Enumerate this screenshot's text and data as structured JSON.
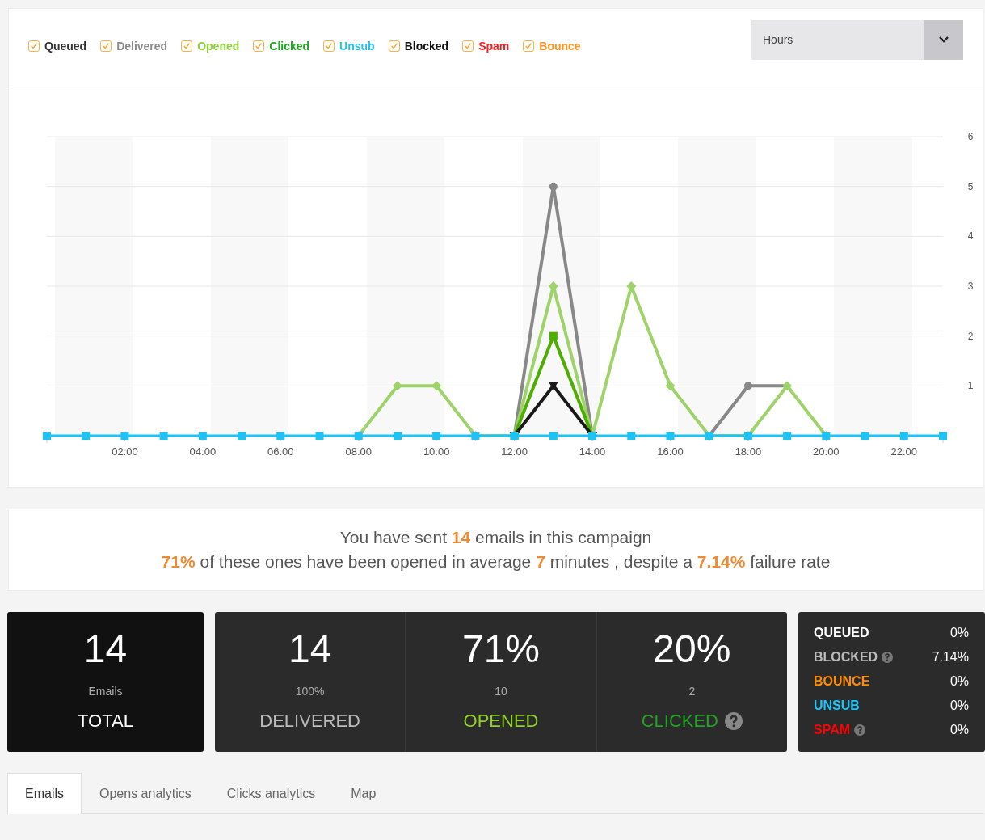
{
  "legend": [
    {
      "label": "Queued",
      "checked": true,
      "color": "#333333"
    },
    {
      "label": "Delivered",
      "checked": true,
      "color": "#8a8a8a"
    },
    {
      "label": "Opened",
      "checked": true,
      "color": "#8fd13a"
    },
    {
      "label": "Clicked",
      "checked": true,
      "color": "#1fa51f"
    },
    {
      "label": "Unsub",
      "checked": true,
      "color": "#1ec3f5"
    },
    {
      "label": "Blocked",
      "checked": true,
      "color": "#111111"
    },
    {
      "label": "Spam",
      "checked": true,
      "color": "#ff1a1a"
    },
    {
      "label": "Bounce",
      "checked": true,
      "color": "#ff9019"
    }
  ],
  "period_select": {
    "value": "Hours"
  },
  "chart_data": {
    "type": "line",
    "grid": true,
    "x": [
      0,
      1,
      2,
      3,
      4,
      5,
      6,
      7,
      8,
      9,
      10,
      11,
      12,
      13,
      14,
      15,
      16,
      17,
      18,
      19,
      20,
      21,
      22,
      23
    ],
    "xlim": [
      0,
      23
    ],
    "ylim": [
      0,
      6
    ],
    "xticks": [
      {
        "value": 2,
        "label": "02:00"
      },
      {
        "value": 4,
        "label": "04:00"
      },
      {
        "value": 6,
        "label": "06:00"
      },
      {
        "value": 8,
        "label": "08:00"
      },
      {
        "value": 10,
        "label": "10:00"
      },
      {
        "value": 12,
        "label": "12:00"
      },
      {
        "value": 14,
        "label": "14:00"
      },
      {
        "value": 16,
        "label": "16:00"
      },
      {
        "value": 18,
        "label": "18:00"
      },
      {
        "value": 20,
        "label": "20:00"
      },
      {
        "value": 22,
        "label": "22:00"
      }
    ],
    "yticks": [
      1,
      2,
      3,
      4,
      5,
      6
    ],
    "series": [
      {
        "color": "#888888",
        "marker": "circle",
        "values": [
          null,
          null,
          null,
          null,
          null,
          null,
          null,
          null,
          null,
          null,
          null,
          null,
          0,
          5,
          0,
          null,
          null,
          0,
          1,
          1,
          null,
          null,
          null,
          null
        ]
      },
      {
        "color": "#9ed36a",
        "marker": "diamond",
        "values": [
          null,
          null,
          null,
          null,
          null,
          null,
          null,
          null,
          0,
          1,
          1,
          0,
          0,
          3,
          0,
          3,
          1,
          0,
          0,
          1,
          0,
          null,
          null,
          null
        ]
      },
      {
        "color": "#4cae00",
        "marker": "square",
        "values": [
          null,
          null,
          null,
          null,
          null,
          null,
          null,
          null,
          null,
          null,
          null,
          null,
          0,
          2,
          0,
          null,
          null,
          null,
          null,
          null,
          null,
          null,
          null,
          null
        ]
      },
      {
        "color": "#1a1a1a",
        "marker": "triangle",
        "values": [
          null,
          null,
          null,
          null,
          null,
          null,
          null,
          null,
          null,
          null,
          null,
          null,
          0,
          1,
          0,
          null,
          null,
          null,
          null,
          null,
          null,
          null,
          null,
          null
        ]
      },
      {
        "color": "#1ec3f5",
        "marker": "square",
        "values": [
          0,
          0,
          0,
          0,
          0,
          0,
          0,
          0,
          0,
          0,
          0,
          0,
          0,
          0,
          0,
          0,
          0,
          0,
          0,
          0,
          0,
          0,
          0,
          0
        ]
      }
    ]
  },
  "summary": {
    "line_1": "You have sent **14** emails in this campaign",
    "line_2": "**71%** of these ones have been opened in average **7** minutes , despite a **7.14%** failure rate"
  },
  "total_card": {
    "value": "14",
    "caption": "Emails",
    "label": "TOTAL"
  },
  "stat_cells": [
    {
      "value": "14",
      "caption": "100%",
      "label": "DELIVERED",
      "color": "#bbbbbb",
      "help": false
    },
    {
      "value": "71%",
      "caption": "10",
      "label": "OPENED",
      "color": "#8fd11f",
      "help": false
    },
    {
      "value": "20%",
      "caption": "2",
      "label": "CLICKED",
      "color": "#1fa51f",
      "help": true
    }
  ],
  "rates": [
    {
      "label": "QUEUED",
      "value": "0%",
      "color": "#ffffff",
      "help": false
    },
    {
      "label": "BLOCKED",
      "value": "7.14%",
      "color": "#bbbbbb",
      "help": true
    },
    {
      "label": "BOUNCE",
      "value": "0%",
      "color": "#ff8c00",
      "help": false
    },
    {
      "label": "UNSUB",
      "value": "0%",
      "color": "#1ec3f5",
      "help": false
    },
    {
      "label": "SPAM",
      "value": "0%",
      "color": "#ff0000",
      "help": true
    }
  ],
  "tabs": [
    {
      "label": "Emails",
      "selected": true
    },
    {
      "label": "Opens analytics",
      "selected": false
    },
    {
      "label": "Clicks analytics",
      "selected": false
    },
    {
      "label": "Map",
      "selected": false
    }
  ]
}
